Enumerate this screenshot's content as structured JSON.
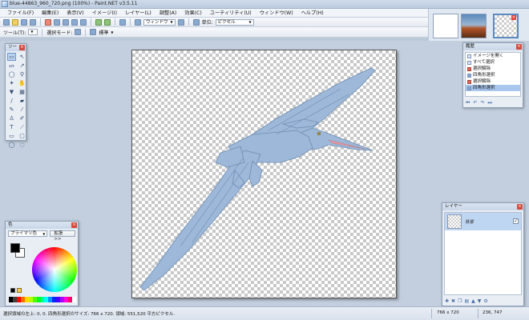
{
  "window": {
    "title": "blue-44863_960_720.png (100%) - Paint.NET v3.5.11"
  },
  "menu": {
    "items": [
      "ファイル(F)",
      "編集(E)",
      "表示(V)",
      "イメージ(I)",
      "レイヤー(L)",
      "調整(A)",
      "効果(C)",
      "ユーティリティ(U)",
      "ウィンドウ(W)",
      "ヘルプ(H)"
    ]
  },
  "toolbar": {
    "window_select": "ウィンドウ",
    "unit_label": "単位:",
    "unit_value": "ピクセル",
    "tool_label": "ツール(T):",
    "selection_mode_label": "選択モード:",
    "standard_value": "標準"
  },
  "tools_panel": {
    "title": "ツー"
  },
  "history_panel": {
    "title": "履歴",
    "items": [
      {
        "label": "イメージを開く",
        "icon": "open-icon"
      },
      {
        "label": "すべて選択",
        "icon": "select-icon"
      },
      {
        "label": "選択解除",
        "icon": "deselect-icon"
      },
      {
        "label": "四角形選択",
        "icon": "rect-select-icon"
      },
      {
        "label": "選択解除",
        "icon": "deselect-icon"
      },
      {
        "label": "四角形選択",
        "icon": "rect-select-icon"
      }
    ],
    "selected_index": 5
  },
  "colors_panel": {
    "title": "色",
    "mode": "プライマリ色",
    "more_button": "拡張 >>",
    "primary": "#000000",
    "secondary": "#ffffff",
    "palette": [
      "#000000",
      "#404040",
      "#ff0000",
      "#ff6a00",
      "#ffd800",
      "#b6ff00",
      "#4cff00",
      "#00ff21",
      "#00ff90",
      "#00ffff",
      "#0094ff",
      "#0026ff",
      "#4800ff",
      "#b200ff",
      "#ff00dc",
      "#ff006e",
      "#ffffff"
    ]
  },
  "layers_panel": {
    "title": "レイヤー",
    "layers": [
      {
        "name": "背景",
        "visible": true
      }
    ]
  },
  "status": {
    "text": "選択領域の左上: 0, 0. 四角形選択のサイズ: 766 x 720. 領域: 551,520 平方ピクセル.",
    "image_size": "766 x 720",
    "cursor_pos": "236, 747"
  },
  "colors": {
    "accent": "#5d89c2",
    "pterosaur": "#9db8d8",
    "pterosaur_outline": "#6f8db3"
  }
}
